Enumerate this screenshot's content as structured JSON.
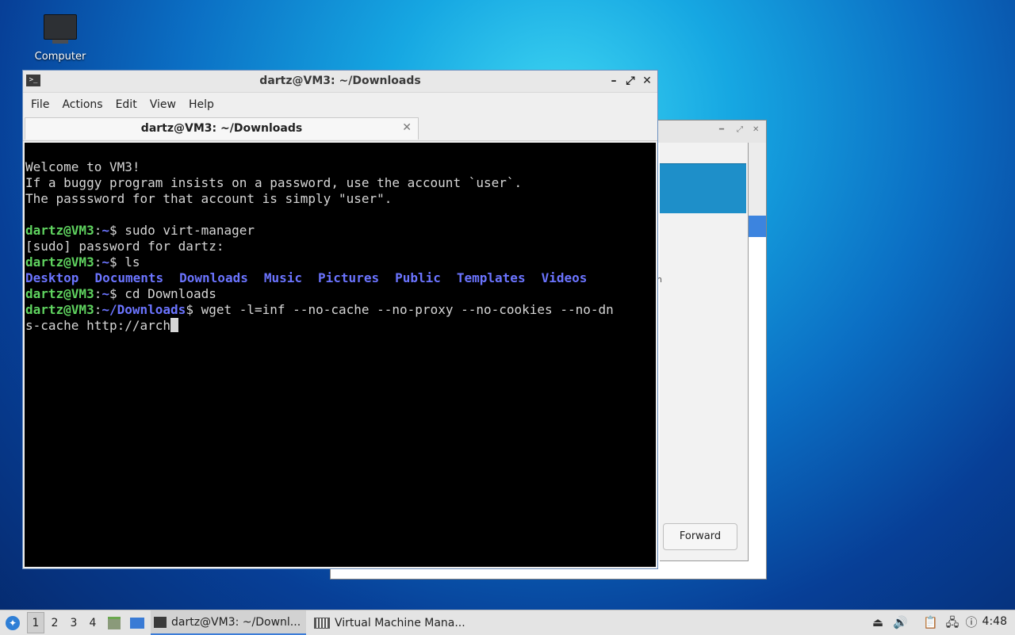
{
  "desktop": {
    "icon_label": "Computer"
  },
  "back_window": {
    "forward_label": "Forward",
    "stray_text": "n"
  },
  "terminal": {
    "title": "dartz@VM3: ~/Downloads",
    "menu": [
      "File",
      "Actions",
      "Edit",
      "View",
      "Help"
    ],
    "tab_label": "dartz@VM3: ~/Downloads",
    "lines": {
      "welcome1": "Welcome to VM3!",
      "welcome2": "If a buggy program insists on a password, use the account `user`.",
      "welcome3": "The passsword for that account is simply \"user\".",
      "prompt_user": "dartz@VM3",
      "home_path": "~",
      "dl_path": "~/Downloads",
      "cmd1": "sudo virt-manager",
      "sudo_prompt": "[sudo] password for dartz:",
      "cmd2": "ls",
      "cmd3": "cd Downloads",
      "cmd4_part1": "wget -l=inf --no-cache --no-proxy --no-cookies --no-dn",
      "cmd4_part2": "s-cache http://arch",
      "dirs": [
        "Desktop",
        "Documents",
        "Downloads",
        "Music",
        "Pictures",
        "Public",
        "Templates",
        "Videos"
      ]
    }
  },
  "taskbar": {
    "workspaces": [
      "1",
      "2",
      "3",
      "4"
    ],
    "active_workspace": "1",
    "tasks": [
      "dartz@VM3: ~/Downl...",
      "Virtual Machine Mana..."
    ],
    "clock": "4:48"
  }
}
